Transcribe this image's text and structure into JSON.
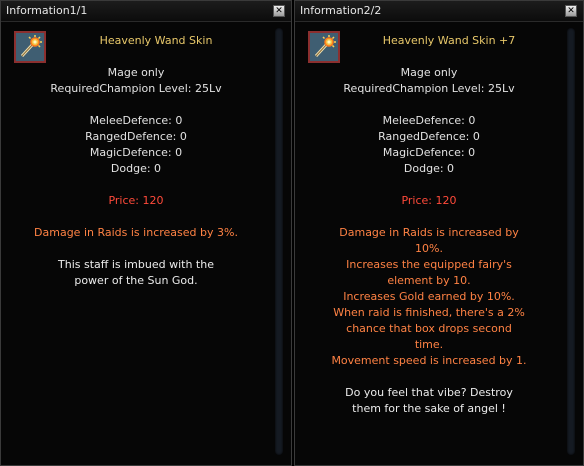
{
  "windows": [
    {
      "title": "Information1/1",
      "close_glyph": "✕",
      "icon": "wand-item-icon",
      "item_name": "Heavenly Wand Skin",
      "restriction": "Mage only",
      "required_level": "RequiredChampion Level: 25Lv",
      "stats": [
        "MeleeDefence: 0",
        "RangedDefence: 0",
        "MagicDefence: 0",
        "Dodge: 0"
      ],
      "price": "Price: 120",
      "effects": [
        "Damage in Raids is increased by 3%."
      ],
      "description": [
        "This staff is imbued with the",
        "power of the Sun God."
      ]
    },
    {
      "title": "Information2/2",
      "close_glyph": "✕",
      "icon": "wand-item-icon",
      "item_name": "Heavenly Wand Skin +7",
      "restriction": "Mage only",
      "required_level": "RequiredChampion Level: 25Lv",
      "stats": [
        "MeleeDefence: 0",
        "RangedDefence: 0",
        "MagicDefence: 0",
        "Dodge: 0"
      ],
      "price": "Price: 120",
      "effects": [
        "Damage in Raids is increased by",
        "10%.",
        "Increases the equipped fairy's",
        "element by 10.",
        "Increases Gold earned by 10%.",
        "When raid is finished, there's a 2%",
        "chance that box drops second",
        "time.",
        "Movement speed is increased by 1."
      ],
      "description": [
        "Do you feel that vibe? Destroy",
        "them for the sake of angel !"
      ]
    }
  ],
  "colors": {
    "item_name": "#e8c86a",
    "price": "#ff4a3a",
    "effect": "#ff8244",
    "text": "#e2e2e2"
  }
}
